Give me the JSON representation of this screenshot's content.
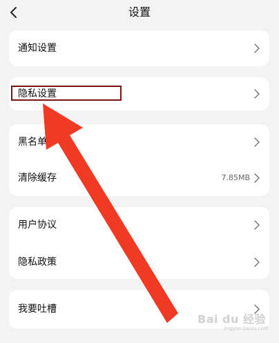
{
  "header": {
    "title": "设置"
  },
  "groups": [
    {
      "items": [
        {
          "label": "通知设置",
          "value": ""
        }
      ]
    },
    {
      "items": [
        {
          "label": "隐私设置",
          "value": ""
        }
      ]
    },
    {
      "items": [
        {
          "label": "黑名单",
          "value": ""
        },
        {
          "label": "清除缓存",
          "value": "7.85MB"
        }
      ]
    },
    {
      "items": [
        {
          "label": "用户协议",
          "value": ""
        },
        {
          "label": "隐私政策",
          "value": ""
        }
      ]
    },
    {
      "items": [
        {
          "label": "我要吐槽",
          "value": ""
        }
      ]
    }
  ],
  "colors": {
    "page_bg": "#f3f3f3",
    "card_bg": "#ffffff",
    "arrow": "#f03a24",
    "highlight_border": "#7a1212"
  },
  "watermark": {
    "brand": "Bai du 经验",
    "url": "jingyan.baidu.com"
  }
}
